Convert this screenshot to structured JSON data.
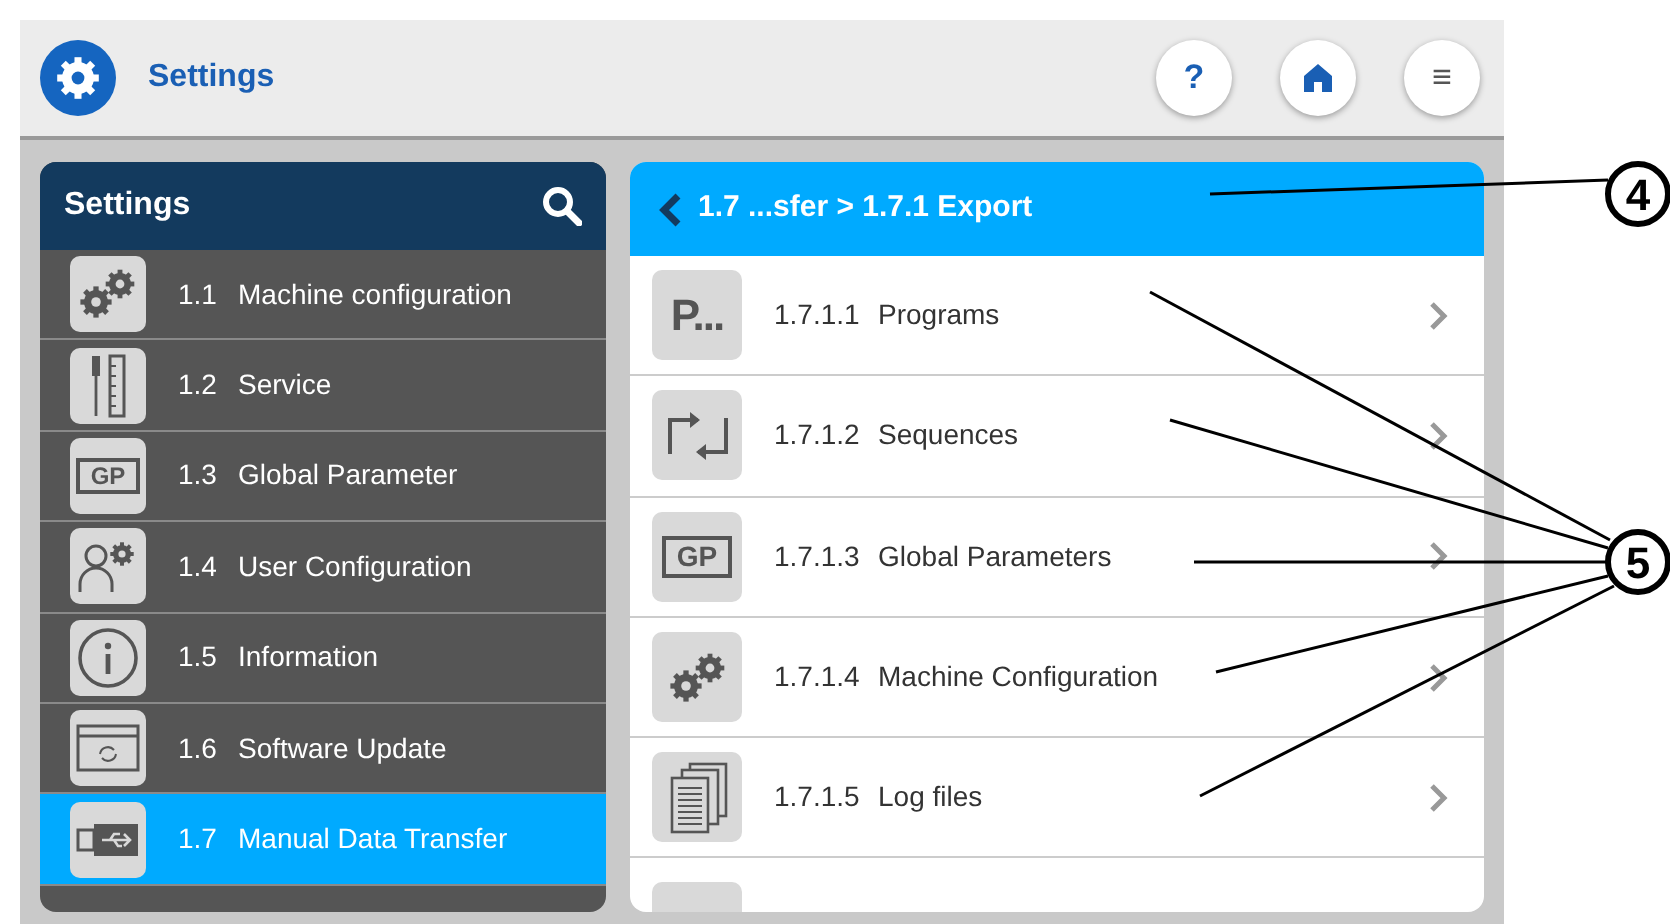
{
  "top_bar": {
    "title": "Settings",
    "help_button": "?",
    "menu_button": "≡"
  },
  "sidebar": {
    "title": "Settings",
    "items": [
      {
        "number": "1.1",
        "label": "Machine configuration",
        "kind": "gears",
        "selected": false
      },
      {
        "number": "1.2",
        "label": "Service",
        "kind": "tools",
        "selected": false
      },
      {
        "number": "1.3",
        "label": "Global Parameter",
        "kind": "text",
        "icon_text": "GP",
        "selected": false
      },
      {
        "number": "1.4",
        "label": "User Configuration",
        "kind": "user",
        "selected": false
      },
      {
        "number": "1.5",
        "label": "Information",
        "kind": "info",
        "selected": false
      },
      {
        "number": "1.6",
        "label": "Software Update",
        "kind": "update",
        "selected": false
      },
      {
        "number": "1.7",
        "label": "Manual Data Transfer",
        "kind": "usb",
        "selected": true
      }
    ]
  },
  "detail": {
    "breadcrumb": "1.7 ...sfer > 1.7.1 Export",
    "items": [
      {
        "number": "1.7.1.1",
        "label": "Programs",
        "kind": "bigtext",
        "icon_text": "P..."
      },
      {
        "number": "1.7.1.2",
        "label": "Sequences",
        "kind": "swap"
      },
      {
        "number": "1.7.1.3",
        "label": "Global Parameters",
        "kind": "text",
        "icon_text": "GP"
      },
      {
        "number": "1.7.1.4",
        "label": "Machine Configuration",
        "kind": "gears"
      },
      {
        "number": "1.7.1.5",
        "label": "Log files",
        "kind": "docs"
      },
      {
        "kind": "cap"
      }
    ]
  },
  "callouts": [
    {
      "label": "4"
    },
    {
      "label": "5"
    }
  ]
}
